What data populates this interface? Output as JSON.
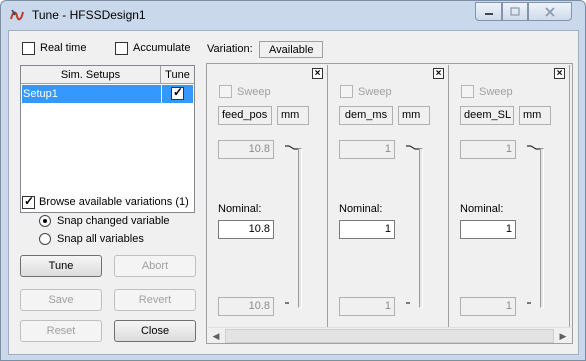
{
  "window": {
    "title": "Tune - HFSSDesign1"
  },
  "options": {
    "real_time": {
      "label": "Real time",
      "checked": false
    },
    "accumulate": {
      "label": "Accumulate",
      "checked": false
    }
  },
  "variation": {
    "label": "Variation:",
    "value": "Available"
  },
  "setups": {
    "columns": [
      "Sim. Setups",
      "Tune"
    ],
    "rows": [
      {
        "name": "Setup1",
        "tune": true
      }
    ]
  },
  "browse": {
    "label": "Browse available variations (1)",
    "checked": true,
    "snap_changed": "Snap changed variable",
    "snap_all": "Snap all variables",
    "selected": "snap_changed"
  },
  "buttons": {
    "tune": "Tune",
    "abort": "Abort",
    "save": "Save",
    "revert": "Revert",
    "reset": "Reset",
    "close": "Close"
  },
  "variables": [
    {
      "sweep_label": "Sweep",
      "name": "feed_pos",
      "unit": "mm",
      "max": "10.8",
      "nominal_label": "Nominal:",
      "nominal": "10.8",
      "min": "10.8",
      "close": "×"
    },
    {
      "sweep_label": "Sweep",
      "name": "dem_ms",
      "unit": "mm",
      "max": "1",
      "nominal_label": "Nominal:",
      "nominal": "1",
      "min": "1",
      "close": "×"
    },
    {
      "sweep_label": "Sweep",
      "name": "deem_SL",
      "unit": "mm",
      "max": "1",
      "nominal_label": "Nominal:",
      "nominal": "1",
      "min": "1",
      "close": "×"
    }
  ],
  "scroll": {
    "left_arrow": "◀",
    "right_arrow": "▶"
  }
}
